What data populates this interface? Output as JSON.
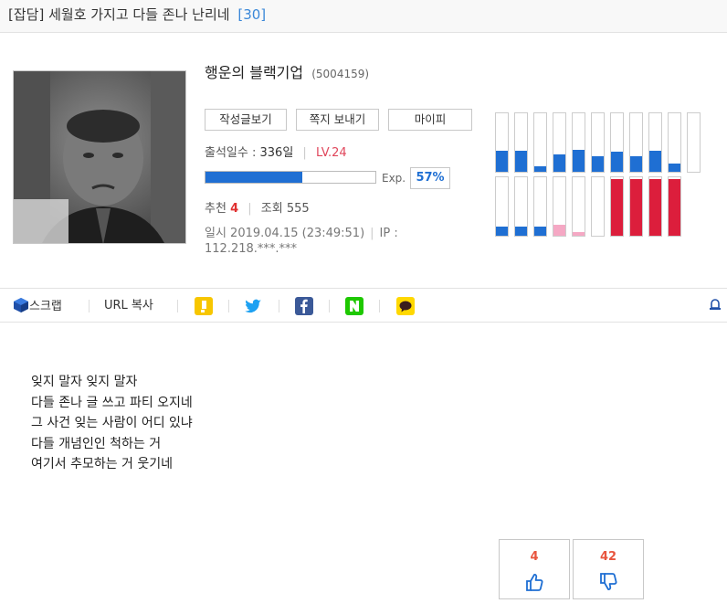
{
  "post": {
    "category": "[잡담]",
    "title": "세월호 가지고 다들 존나 난리네",
    "comment_count": "[30]"
  },
  "author": {
    "nickname": "행운의 블랙기업",
    "user_id": "(5004159)",
    "buttons": [
      "작성글보기",
      "쪽지 보내기",
      "마이피"
    ],
    "attendance_label": "출석일수 :",
    "attendance_value": "336일",
    "level": "LV.24",
    "exp_label": "Exp.",
    "exp_percent": "57%",
    "exp_progress": 0.57
  },
  "stats": {
    "recommend_label": "추천",
    "recommend_value": "4",
    "views_label": "조회",
    "views_value": "555",
    "datetime": "일시 2019.04.15 (23:49:51)",
    "ip": "IP : 112.218.***.***"
  },
  "activity_bars": {
    "rows": [
      [
        {
          "fill": 0.36,
          "color": "#1f6fd3"
        },
        {
          "fill": 0.36,
          "color": "#1f6fd3"
        },
        {
          "fill": 0.1,
          "color": "#1f6fd3"
        },
        {
          "fill": 0.3,
          "color": "#1f6fd3"
        },
        {
          "fill": 0.38,
          "color": "#1f6fd3"
        },
        {
          "fill": 0.26,
          "color": "#1f6fd3"
        },
        {
          "fill": 0.34,
          "color": "#1f6fd3"
        },
        {
          "fill": 0.26,
          "color": "#1f6fd3"
        },
        {
          "fill": 0.36,
          "color": "#1f6fd3"
        },
        {
          "fill": 0.14,
          "color": "#1f6fd3"
        },
        {
          "fill": 0,
          "color": "#1f6fd3"
        }
      ],
      [
        {
          "fill": 0.15,
          "color": "#1f6fd3"
        },
        {
          "fill": 0.15,
          "color": "#1f6fd3"
        },
        {
          "fill": 0.15,
          "color": "#1f6fd3"
        },
        {
          "fill": 0.19,
          "color": "#f5a8c4"
        },
        {
          "fill": 0.06,
          "color": "#f5a8c4"
        },
        {
          "fill": 0,
          "color": "#1f6fd3"
        },
        {
          "fill": 0.97,
          "color": "#dc1e3c"
        },
        {
          "fill": 0.97,
          "color": "#dc1e3c"
        },
        {
          "fill": 0.97,
          "color": "#dc1e3c"
        },
        {
          "fill": 0.97,
          "color": "#dc1e3c"
        }
      ]
    ]
  },
  "share": {
    "scrap_label": "스크랩",
    "url_copy_label": "URL 복사",
    "icons": [
      "kakaostory-icon",
      "twitter-icon",
      "facebook-icon",
      "naver-icon",
      "kakaotalk-icon"
    ]
  },
  "content": {
    "lines": [
      "잊지 말자 잊지 말자",
      "다들 존나 글 쓰고 파티 오지네",
      "그 사건 잊는 사람이 어디 있냐",
      "다들 개념인인 척하는 거",
      "여기서 추모하는 거 웃기네"
    ]
  },
  "votes": {
    "up": "4",
    "down": "42"
  },
  "colors": {
    "accent_blue": "#1f6fd3",
    "level_red": "#e0465b",
    "vote_orange": "#e8553e"
  }
}
